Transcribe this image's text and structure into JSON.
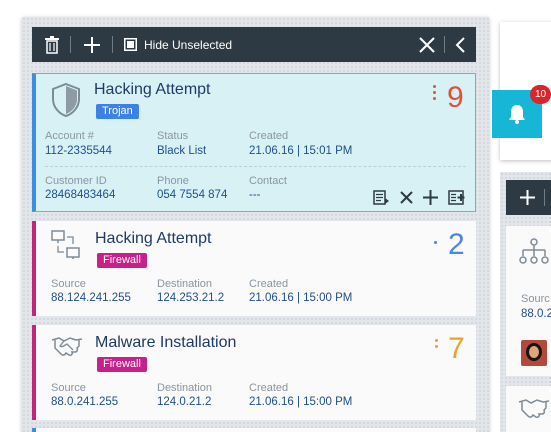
{
  "toolbar": {
    "hide_unselected_label": "Hide Unselected",
    "icons": [
      "trash-icon",
      "plus-icon",
      "checkbox-icon",
      "close-icon",
      "chevron-left-icon"
    ]
  },
  "alerts": [
    {
      "title": "Hacking Attempt",
      "tag": "Trojan",
      "count": "9",
      "count_color": "#e2503a",
      "fields": [
        {
          "label": "Account #",
          "value": "112-2335544"
        },
        {
          "label": "Status",
          "value": "Black List"
        },
        {
          "label": "Created",
          "value": "21.06.16 | 15:01 PM"
        },
        {
          "label": "Customer ID",
          "value": "28468483464"
        },
        {
          "label": "Phone",
          "value": "054 7554 874"
        },
        {
          "label": "Contact",
          "value": "---"
        }
      ]
    },
    {
      "title": "Hacking Attempt",
      "tag": "Firewall",
      "count": "2",
      "count_color": "#4a86e8",
      "fields": [
        {
          "label": "Source",
          "value": "88.124.241.255"
        },
        {
          "label": "Destination",
          "value": "124.253.21.2"
        },
        {
          "label": "Created",
          "value": "21.06.16 | 15:00 PM"
        }
      ]
    },
    {
      "title": "Malware Installation",
      "tag": "Firewall",
      "count": "7",
      "count_color": "#f0a030",
      "fields": [
        {
          "label": "Source",
          "value": "88.0.241.255"
        },
        {
          "label": "Destination",
          "value": "124.0.21.2"
        },
        {
          "label": "Created",
          "value": "21.06.16 | 15:00 PM"
        }
      ]
    }
  ],
  "notifications": {
    "badge_count": "10"
  },
  "right_card": {
    "label_partial": "Sourc",
    "value_partial": "88.0.2"
  }
}
